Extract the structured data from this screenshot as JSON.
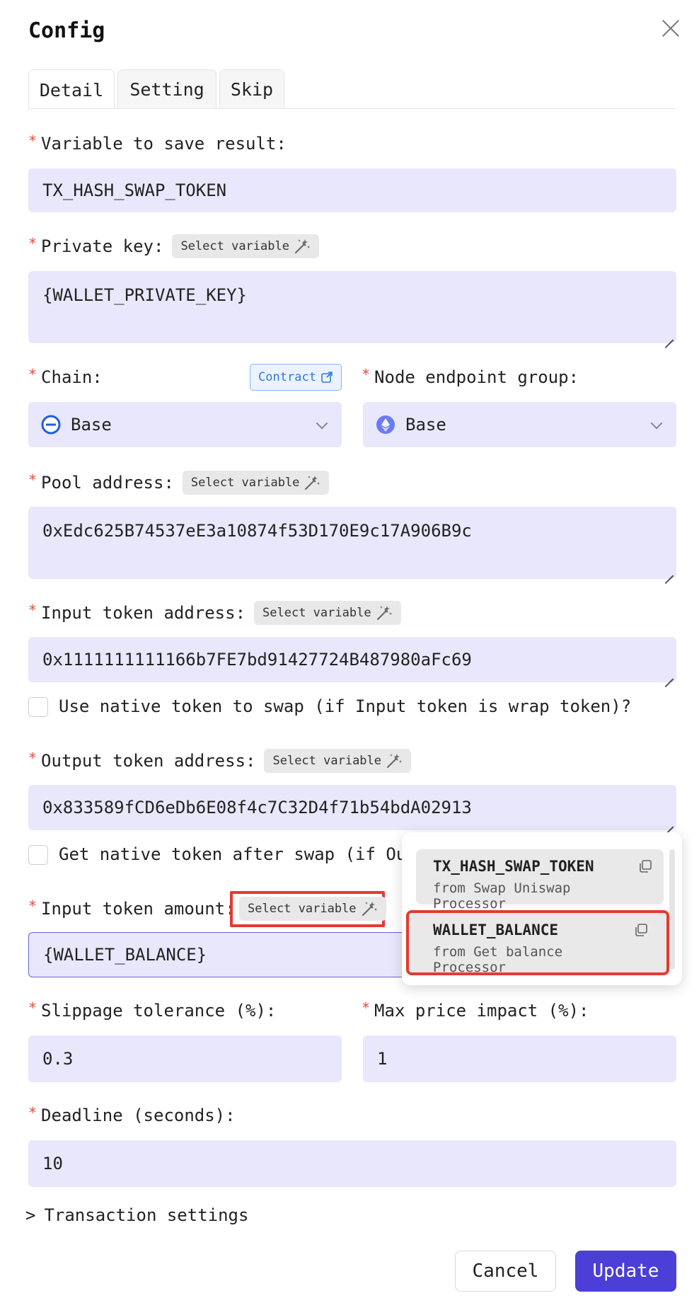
{
  "dialog": {
    "title": "Config"
  },
  "tabs": [
    {
      "label": "Detail"
    },
    {
      "label": "Setting"
    },
    {
      "label": "Skip"
    }
  ],
  "select_variable_label": "Select variable",
  "fields": {
    "variable": {
      "label": "Variable to save result:",
      "value": "TX_HASH_SWAP_TOKEN"
    },
    "private_key": {
      "label": "Private key:",
      "value": "{WALLET_PRIVATE_KEY}"
    },
    "chain": {
      "label": "Chain:",
      "value": "Base",
      "contract_label": "Contract"
    },
    "node_group": {
      "label": "Node endpoint group:",
      "value": "Base"
    },
    "pool": {
      "label": "Pool address:",
      "value": "0xEdc625B74537eE3a10874f53D170E9c17A906B9c"
    },
    "input_token": {
      "label": "Input token address:",
      "value": "0x1111111111166b7FE7bd91427724B487980aFc69"
    },
    "native_input": {
      "label": "Use native token to swap (if Input token is wrap token)?"
    },
    "output_token": {
      "label": "Output token address:",
      "value": "0x833589fCD6eDb6E08f4c7C32D4f71b54bdA02913"
    },
    "native_output": {
      "label": "Get native token after swap (if Ou"
    },
    "input_amount": {
      "label": "Input token amount:",
      "value": "{WALLET_BALANCE}"
    },
    "slippage": {
      "label": "Slippage tolerance (%):",
      "value": "0.3"
    },
    "max_impact": {
      "label": "Max price impact (%):",
      "value": "1"
    },
    "deadline": {
      "label": "Deadline (seconds):",
      "value": "10"
    }
  },
  "transaction_settings": {
    "arrow": ">",
    "label": "Transaction settings"
  },
  "variable_popup": {
    "items": [
      {
        "name": "TX_HASH_SWAP_TOKEN",
        "source": "from Swap Uniswap Processor"
      },
      {
        "name": "WALLET_BALANCE",
        "source": "from Get balance Processor"
      }
    ]
  },
  "buttons": {
    "cancel": "Cancel",
    "update": "Update"
  },
  "colors": {
    "accent": "#4b3fd8",
    "field_bg": "#e9e7fb",
    "required": "#e24a3b",
    "highlight": "#e33b2f"
  },
  "icons": [
    "close-icon",
    "magic-wand-icon",
    "external-link-icon",
    "base-chain-icon",
    "ethereum-icon",
    "chevron-down-icon",
    "copy-icon",
    "chevron-right-icon"
  ]
}
